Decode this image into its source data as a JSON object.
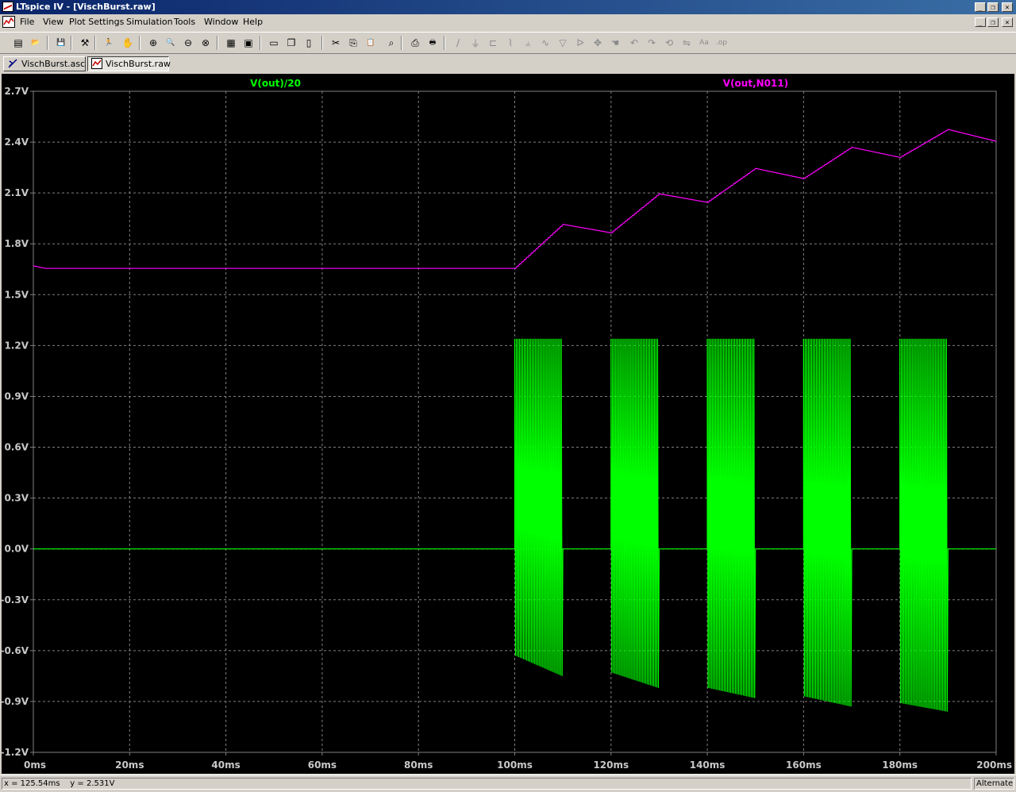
{
  "window": {
    "title": "LTspice IV - [VischBurst.raw]",
    "controls": [
      "_",
      "❐",
      "×"
    ],
    "mdi_controls": [
      "_",
      "❐",
      "×"
    ]
  },
  "menu": {
    "items": [
      "File",
      "View",
      "Plot Settings",
      "Simulation",
      "Tools",
      "Window",
      "Help"
    ]
  },
  "toolbar": {
    "buttons": [
      {
        "icon": "new-schematic-icon",
        "glyph": "▤"
      },
      {
        "icon": "open-icon",
        "glyph": "📂"
      },
      {
        "icon": "save-icon",
        "glyph": "💾"
      },
      {
        "icon": "control-panel-icon",
        "glyph": "⚒"
      },
      {
        "icon": "run-icon",
        "glyph": "🏃"
      },
      {
        "icon": "halt-icon",
        "glyph": "✋"
      },
      {
        "icon": "zoom-in-icon",
        "glyph": "⊕"
      },
      {
        "icon": "zoom-pan-icon",
        "glyph": "🔍"
      },
      {
        "icon": "zoom-out-icon",
        "glyph": "⊖"
      },
      {
        "icon": "zoom-cancel-icon",
        "glyph": "⊗"
      },
      {
        "icon": "autorange-icon",
        "glyph": "▦"
      },
      {
        "icon": "fit-icon",
        "glyph": "▣"
      },
      {
        "icon": "tile-horizontal-icon",
        "glyph": "▭"
      },
      {
        "icon": "cascade-icon",
        "glyph": "❐"
      },
      {
        "icon": "tile-vertical-icon",
        "glyph": "▯"
      },
      {
        "icon": "cut-icon",
        "glyph": "✂"
      },
      {
        "icon": "copy-icon",
        "glyph": "⎘"
      },
      {
        "icon": "paste-icon",
        "glyph": "📋"
      },
      {
        "icon": "find-icon",
        "glyph": "⌕"
      },
      {
        "icon": "print-preview-icon",
        "glyph": "⎙"
      },
      {
        "icon": "print-icon",
        "glyph": "🖶"
      },
      {
        "icon": "wire-icon",
        "glyph": "∕"
      },
      {
        "icon": "ground-icon",
        "glyph": "⏚"
      },
      {
        "icon": "label-net-icon",
        "glyph": "⊏"
      },
      {
        "icon": "resistor-icon",
        "glyph": "⌇"
      },
      {
        "icon": "capacitor-icon",
        "glyph": "⫨"
      },
      {
        "icon": "inductor-icon",
        "glyph": "∿"
      },
      {
        "icon": "diode-icon",
        "glyph": "▽"
      },
      {
        "icon": "component-icon",
        "glyph": "ᐅ"
      },
      {
        "icon": "move-icon",
        "glyph": "✥"
      },
      {
        "icon": "drag-icon",
        "glyph": "☚"
      },
      {
        "icon": "undo-icon",
        "glyph": "↶"
      },
      {
        "icon": "redo-icon",
        "glyph": "↷"
      },
      {
        "icon": "rotate-icon",
        "glyph": "⟲"
      },
      {
        "icon": "mirror-icon",
        "glyph": "⇋"
      },
      {
        "icon": "text-icon",
        "glyph": "Aa"
      },
      {
        "icon": "spice-directive-icon",
        "glyph": ".op"
      }
    ]
  },
  "tabs": [
    {
      "label": "VischBurst.asc",
      "icon": "schematic-tab-icon"
    },
    {
      "label": "VischBurst.raw",
      "icon": "waveform-tab-icon"
    }
  ],
  "colors": {
    "background": "#000000",
    "grid": "#808080",
    "axis_text": "#c8c8c8",
    "trace1": "#00ff00",
    "trace2": "#ff00ff"
  },
  "chart_data": {
    "type": "line",
    "title": "",
    "xlabel": "",
    "ylabel": "",
    "xlim": [
      0,
      200
    ],
    "ylim": [
      -1.2,
      2.7
    ],
    "x_unit": "ms",
    "y_unit": "V",
    "x_ticks": [
      "0ms",
      "20ms",
      "40ms",
      "60ms",
      "80ms",
      "100ms",
      "120ms",
      "140ms",
      "160ms",
      "180ms",
      "200ms"
    ],
    "y_ticks": [
      "2.7V",
      "2.4V",
      "2.1V",
      "1.8V",
      "1.5V",
      "1.2V",
      "0.9V",
      "0.6V",
      "0.3V",
      "0.0V",
      "-0.3V",
      "-0.6V",
      "-0.9V",
      "-1.2V"
    ],
    "grid": true,
    "legend": "top",
    "series": [
      {
        "name": "V(out)/20",
        "color": "#00ff00",
        "style": "burst",
        "baseline": 0.0,
        "bursts": [
          {
            "start": 100,
            "end": 110,
            "peak": 1.24,
            "trough_start": -0.63,
            "trough_end": -0.75,
            "cycles": 10
          },
          {
            "start": 120,
            "end": 130,
            "peak": 1.24,
            "trough_start": -0.73,
            "trough_end": -0.82,
            "cycles": 10
          },
          {
            "start": 140,
            "end": 150,
            "peak": 1.24,
            "trough_start": -0.82,
            "trough_end": -0.88,
            "cycles": 10
          },
          {
            "start": 160,
            "end": 170,
            "peak": 1.24,
            "trough_start": -0.87,
            "trough_end": -0.93,
            "cycles": 10
          },
          {
            "start": 180,
            "end": 190,
            "peak": 1.24,
            "trough_start": -0.91,
            "trough_end": -0.96,
            "cycles": 10
          }
        ]
      },
      {
        "name": "V(out,N011)",
        "color": "#ff00ff",
        "x": [
          0,
          2.5,
          100,
          110,
          120,
          130,
          140,
          150,
          160,
          170,
          180,
          190,
          200
        ],
        "y": [
          1.67,
          1.655,
          1.655,
          1.915,
          1.865,
          2.095,
          2.045,
          2.245,
          2.185,
          2.37,
          2.31,
          2.475,
          2.405
        ]
      }
    ]
  },
  "status": {
    "coords": "x = 125.54ms    y = 2.531V",
    "mode": "Alternate"
  }
}
